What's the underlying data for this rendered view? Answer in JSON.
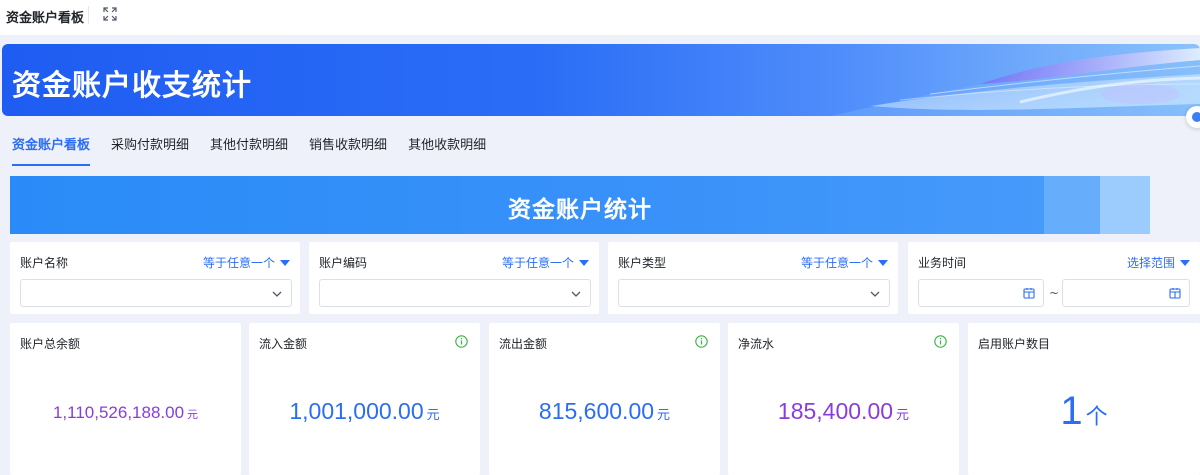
{
  "app": {
    "title": "资金账户看板"
  },
  "banner": {
    "title": "资金账户收支统计"
  },
  "tabs": [
    {
      "label": "资金账户看板",
      "active": true
    },
    {
      "label": "采购付款明细",
      "active": false
    },
    {
      "label": "其他付款明细",
      "active": false
    },
    {
      "label": "销售收款明细",
      "active": false
    },
    {
      "label": "其他收款明细",
      "active": false
    }
  ],
  "section": {
    "title": "资金账户统计"
  },
  "filters": {
    "account_name": {
      "label": "账户名称",
      "operator": "等于任意一个",
      "value": ""
    },
    "account_code": {
      "label": "账户编码",
      "operator": "等于任意一个",
      "value": ""
    },
    "account_type": {
      "label": "账户类型",
      "operator": "等于任意一个",
      "value": ""
    },
    "business_time": {
      "label": "业务时间",
      "operator": "选择范围",
      "start": "",
      "end": "",
      "separator": "~"
    }
  },
  "kpis": {
    "total_balance": {
      "label": "账户总余额",
      "value": "1,110,526,188.00",
      "unit": "元",
      "color": "#8a3ce0"
    },
    "inflow": {
      "label": "流入金额",
      "value": "1,001,000.00",
      "unit": "元",
      "color": "#2b6df6"
    },
    "outflow": {
      "label": "流出金额",
      "value": "815,600.00",
      "unit": "元",
      "color": "#2b6df6"
    },
    "net_flow": {
      "label": "净流水",
      "value": "185,400.00",
      "unit": "元",
      "color": "#8a3ce0"
    },
    "active_accounts": {
      "label": "启用账户数目",
      "value": "1",
      "unit": "个",
      "color": "#2b6df6"
    }
  },
  "icons": {
    "fullscreen": "expand-icon",
    "info": "info-circle-icon",
    "dropdown": "chevron-down-icon",
    "calendar": "calendar-icon"
  },
  "colors": {
    "accent": "#2b6df6",
    "info_green": "#3bb346",
    "purple": "#8a3ce0",
    "canvas": "#eef1f9"
  }
}
